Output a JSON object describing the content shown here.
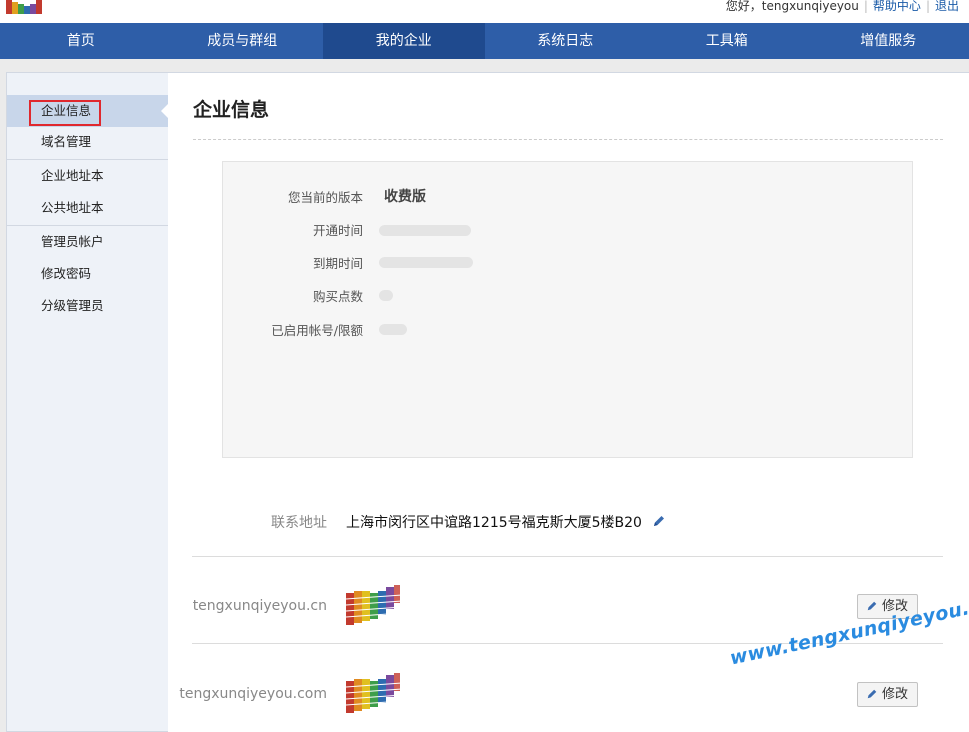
{
  "header": {
    "greeting": "您好，tengxunqiyeyou",
    "help_link": "帮助中心",
    "logout_link": "退出"
  },
  "nav": {
    "items": [
      {
        "label": "首页"
      },
      {
        "label": "成员与群组"
      },
      {
        "label": "我的企业"
      },
      {
        "label": "系统日志"
      },
      {
        "label": "工具箱"
      },
      {
        "label": "增值服务"
      }
    ],
    "active": "我的企业"
  },
  "sidebar": {
    "items": [
      {
        "label": "企业信息"
      },
      {
        "label": "域名管理"
      },
      {
        "label": "企业地址本"
      },
      {
        "label": "公共地址本"
      },
      {
        "label": "管理员帐户"
      },
      {
        "label": "修改密码"
      },
      {
        "label": "分级管理员"
      }
    ],
    "active": "企业信息"
  },
  "main": {
    "title": "企业信息",
    "info": {
      "version_label": "您当前的版本",
      "version_value": "收费版",
      "open_time_label": "开通时间",
      "expire_time_label": "到期时间",
      "points_label": "购买点数",
      "accounts_label": "已启用帐号/限额"
    },
    "address": {
      "label": "联系地址",
      "value": "上海市闵行区中谊路1215号福克斯大厦5楼B20"
    },
    "domains": [
      {
        "name": "tengxunqiyeyou.cn",
        "edit_label": "修改"
      },
      {
        "name": "tengxunqiyeyou.com",
        "edit_label": "修改"
      }
    ]
  },
  "watermark": "www.tengxunqiyeyou.com",
  "colors": {
    "nav_bg": "#2e5ea8",
    "nav_active": "#1f4a8e",
    "sidebar_bg": "#eef2f8",
    "highlight_box": "#e0282e",
    "link": "#1a5ba8",
    "watermark": "#2a8be0"
  },
  "icons": {
    "logo": "company-logo-icon",
    "pencil": "pencil-icon"
  }
}
